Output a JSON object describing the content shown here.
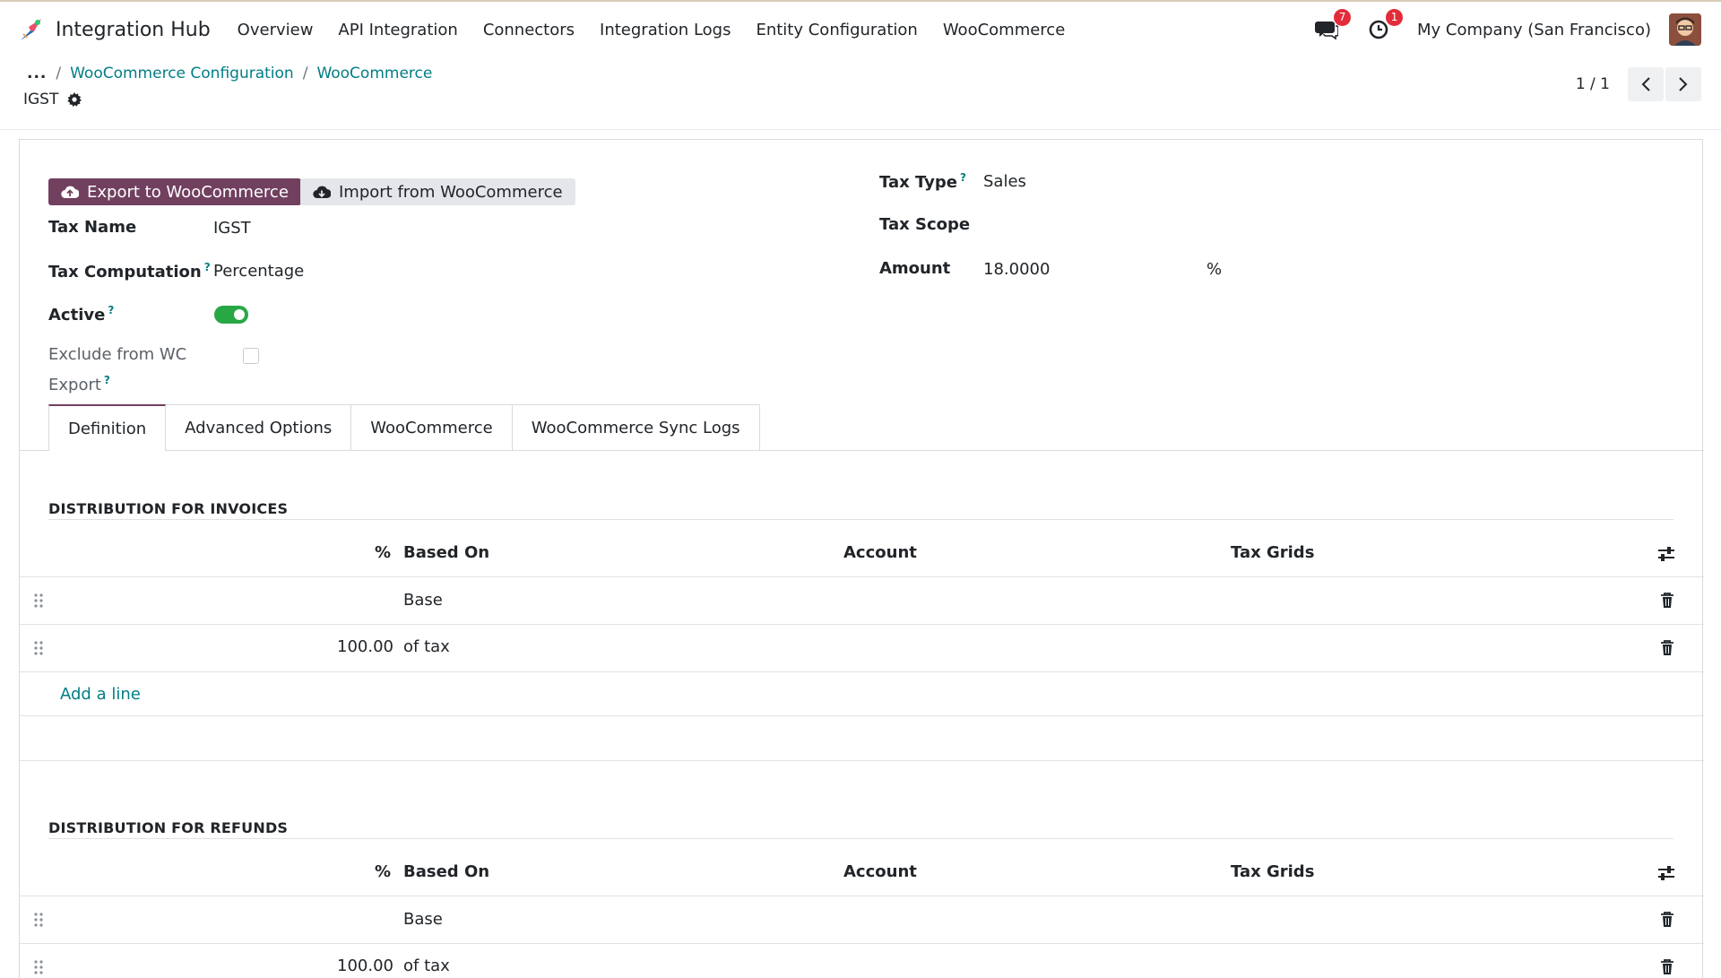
{
  "app": {
    "name": "Integration Hub",
    "menu": [
      "Overview",
      "API Integration",
      "Connectors",
      "Integration Logs",
      "Entity Configuration",
      "WooCommerce"
    ],
    "messages_count": "7",
    "activities_count": "1",
    "company": "My Company (San Francisco)"
  },
  "breadcrumb": {
    "dots": "...",
    "items": [
      "WooCommerce Configuration",
      "WooCommerce"
    ]
  },
  "record": {
    "title": "IGST"
  },
  "pager": {
    "value": "1 / 1"
  },
  "buttons": {
    "export": "Export to WooCommerce",
    "import": "Import from WooCommerce"
  },
  "form": {
    "tax_name_label": "Tax Name",
    "tax_name": "IGST",
    "tax_computation_label": "Tax Computation",
    "tax_computation": "Percentage",
    "active_label": "Active",
    "active": true,
    "exclude_label_line1": "Exclude from WC",
    "exclude_label_line2": "Export",
    "exclude": false,
    "tax_type_label": "Tax Type",
    "tax_type": "Sales",
    "tax_scope_label": "Tax Scope",
    "tax_scope": "",
    "amount_label": "Amount",
    "amount": "18.0000",
    "amount_unit": "%",
    "help_mark": "?"
  },
  "tabs": [
    "Definition",
    "Advanced Options",
    "WooCommerce",
    "WooCommerce Sync Logs"
  ],
  "invoices": {
    "title": "DISTRIBUTION FOR INVOICES",
    "columns": [
      "%",
      "Based On",
      "Account",
      "Tax Grids"
    ],
    "rows": [
      {
        "percent": "",
        "based_on": "Base",
        "account": "",
        "tax_grids": ""
      },
      {
        "percent": "100.00",
        "based_on": "of tax",
        "account": "",
        "tax_grids": ""
      }
    ],
    "add_line": "Add a line"
  },
  "refunds": {
    "title": "DISTRIBUTION FOR REFUNDS",
    "columns": [
      "%",
      "Based On",
      "Account",
      "Tax Grids"
    ],
    "rows": [
      {
        "percent": "",
        "based_on": "Base",
        "account": "",
        "tax_grids": ""
      },
      {
        "percent": "100.00",
        "based_on": "of tax",
        "account": "",
        "tax_grids": ""
      }
    ]
  },
  "colors": {
    "primary": "#71405f",
    "link": "#017e84",
    "toggle_on": "#28a745",
    "badge": "#e32c39"
  }
}
